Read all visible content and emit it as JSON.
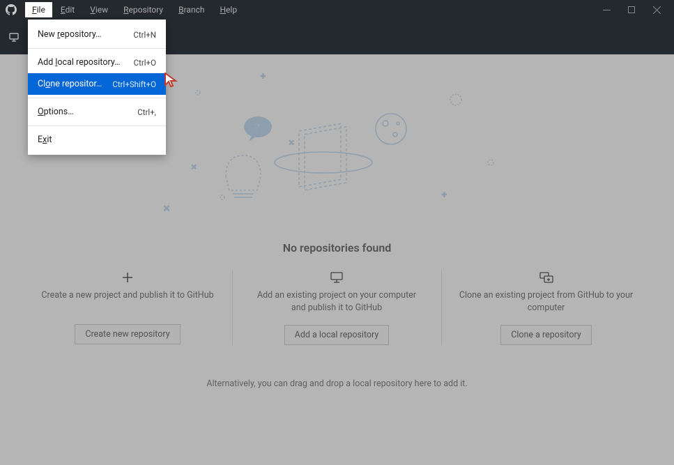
{
  "menubar": {
    "items": [
      {
        "label": "File",
        "underline": "F",
        "rest": "ile",
        "active": true
      },
      {
        "label": "Edit",
        "underline": "E",
        "rest": "dit"
      },
      {
        "label": "View",
        "underline": "V",
        "rest": "iew"
      },
      {
        "label": "Repository",
        "underline": "R",
        "rest": "epository"
      },
      {
        "label": "Branch",
        "underline": "B",
        "rest": "ranch"
      },
      {
        "label": "Help",
        "underline": "H",
        "rest": "elp"
      }
    ]
  },
  "dropdown": {
    "items": [
      {
        "label_pre": "New ",
        "underline": "r",
        "label_post": "epository…",
        "shortcut": "Ctrl+N",
        "highlighted": false
      },
      {
        "sep": true
      },
      {
        "label_pre": "Add ",
        "underline": "l",
        "label_post": "ocal repository…",
        "shortcut": "Ctrl+O",
        "highlighted": false
      },
      {
        "label_pre": "Cl",
        "underline": "o",
        "label_post": "ne repositor…",
        "shortcut": "Ctrl+Shift+O",
        "highlighted": true
      },
      {
        "sep": true
      },
      {
        "label_pre": "",
        "underline": "O",
        "label_post": "ptions…",
        "shortcut": "Ctrl+,",
        "highlighted": false
      },
      {
        "sep": true
      },
      {
        "label_pre": "E",
        "underline": "x",
        "label_post": "it",
        "shortcut": "",
        "highlighted": false
      }
    ]
  },
  "empty": {
    "heading": "No repositories found",
    "cols": [
      {
        "icon": "plus-icon",
        "text": "Create a new project and publish it to GitHub",
        "button": "Create new repository"
      },
      {
        "icon": "monitor-icon",
        "text": "Add an existing project on your computer and publish it to GitHub",
        "button": "Add a local repository"
      },
      {
        "icon": "clone-icon",
        "text": "Clone an existing project from GitHub to your computer",
        "button": "Clone a repository"
      }
    ],
    "alt": "Alternatively, you can drag and drop a local repository here to add it."
  }
}
